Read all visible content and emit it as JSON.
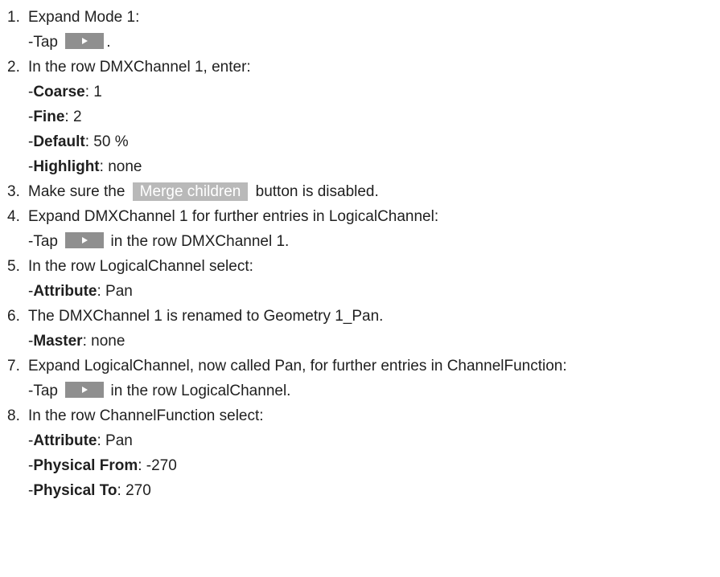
{
  "steps": [
    {
      "num": "1.",
      "text": "Expand Mode 1:",
      "sub": {
        "pre": "-Tap",
        "post": "."
      }
    },
    {
      "num": "2.",
      "text": "In the row DMXChannel 1, enter:",
      "fields": [
        {
          "label": "Coarse",
          "value": ": 1"
        },
        {
          "label": "Fine",
          "value": ": 2"
        },
        {
          "label": "Default",
          "value": ": 50 %"
        },
        {
          "label": "Highlight",
          "value": ": none"
        }
      ]
    },
    {
      "num": "3.",
      "pre": "Make sure the",
      "button": "Merge children",
      "post": "button is disabled."
    },
    {
      "num": "4.",
      "text": "Expand DMXChannel 1 for further entries in LogicalChannel:",
      "sub": {
        "pre": "-Tap",
        "post": "in the row DMXChannel 1."
      }
    },
    {
      "num": "5.",
      "text": "In the row LogicalChannel select:",
      "fields": [
        {
          "label": "Attribute",
          "value": ": Pan"
        }
      ]
    },
    {
      "num": "6.",
      "text": "The DMXChannel 1 is renamed to Geometry 1_Pan.",
      "fields": [
        {
          "label": "Master",
          "value": ": none"
        }
      ]
    },
    {
      "num": "7.",
      "text": "Expand LogicalChannel, now called Pan, for further entries in ChannelFunction:",
      "sub": {
        "pre": "-Tap",
        "post": "in the row LogicalChannel."
      }
    },
    {
      "num": "8.",
      "text": "In the row ChannelFunction select:",
      "fields": [
        {
          "label": "Attribute",
          "value": ": Pan"
        },
        {
          "label": "Physical From",
          "value": ": -270"
        },
        {
          "label": "Physical To",
          "value": ": 270"
        }
      ]
    }
  ],
  "icons": {
    "play": "play-icon"
  }
}
